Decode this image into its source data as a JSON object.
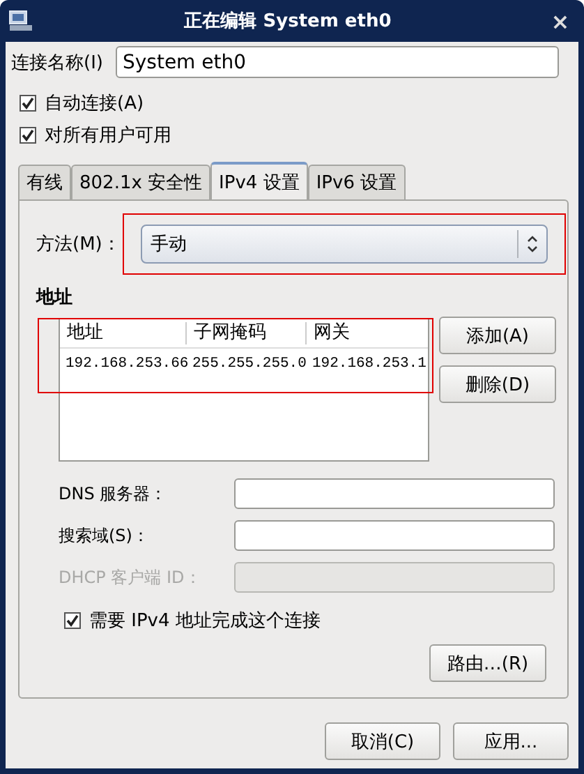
{
  "window": {
    "title": "正在编辑 System eth0",
    "close": "×"
  },
  "connection_name": {
    "label": "连接名称(I)",
    "value": "System eth0"
  },
  "options": [
    {
      "label": "自动连接(A)",
      "checked": true
    },
    {
      "label": "对所有用户可用",
      "checked": true
    }
  ],
  "tabs": [
    {
      "label": "有线",
      "selected": false
    },
    {
      "label": "802.1x 安全性",
      "selected": false
    },
    {
      "label": "IPv4 设置",
      "selected": true
    },
    {
      "label": "IPv6 设置",
      "selected": false
    }
  ],
  "method": {
    "label": "方法(M)：",
    "value": "手动",
    "highlighted": true
  },
  "addresses": {
    "heading": "地址",
    "columns": [
      "地址",
      "子网掩码",
      "网关"
    ],
    "rows": [
      [
        "192.168.253.66",
        "255.255.255.0",
        "192.168.253.1"
      ]
    ],
    "highlighted": true,
    "buttons": [
      "添加(A)",
      "删除(D)"
    ]
  },
  "fields": [
    {
      "label": "DNS 服务器：",
      "disabled": false
    },
    {
      "label": "搜索域(S)：",
      "disabled": false
    },
    {
      "label": "DHCP 客户端 ID：",
      "disabled": true
    }
  ],
  "require_ipv4": {
    "label": "需要 IPv4 地址完成这个连接",
    "checked": true
  },
  "routes_button": "路由…(R)",
  "buttons": [
    "取消(C)",
    "应用..."
  ]
}
